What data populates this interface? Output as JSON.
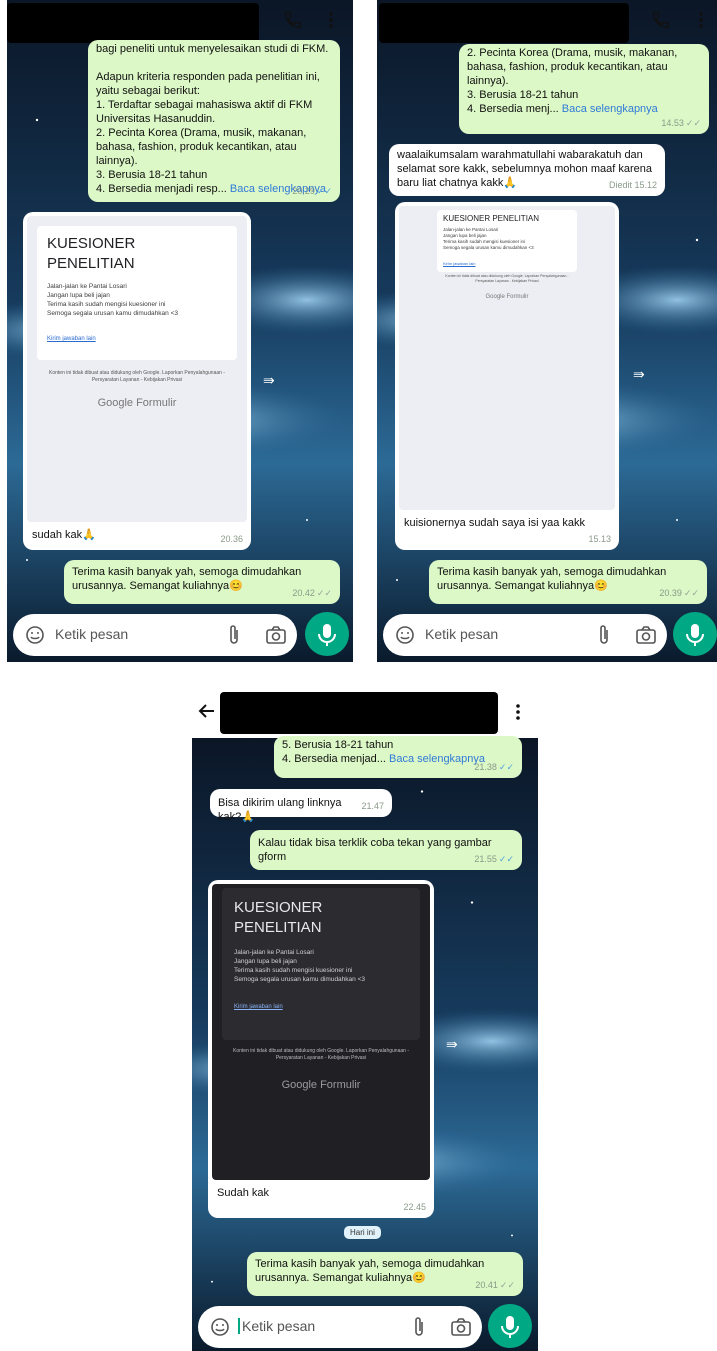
{
  "colors": {
    "accent": "#00a884",
    "outgoing": "#dcf8c6",
    "incoming": "#ffffff",
    "read_tick": "#4fa3e0",
    "link": "#2f7ad8"
  },
  "icons": {
    "call": "phone-icon",
    "menu": "more-vert-icon",
    "back": "back-arrow-icon",
    "emoji": "emoji-icon",
    "attach": "paperclip-icon",
    "camera": "camera-icon",
    "mic": "mic-icon",
    "forward": "forward-icon"
  },
  "read_more": "Baca selengkapnya",
  "input_placeholder": "Ketik pesan",
  "form": {
    "title": "KUESIONER PENELITIAN",
    "body": "Jalan-jalan ke Pantai Losari\nJangan lupa beli jajan\nTerima kasih sudah mengisi kuesioner ini\nSemoga segala urusan kamu dimudahkan <3",
    "link": "Kirim jawaban lain",
    "footer": "Konten ini tidak dibuat atau didukung oleh Google. Laporkan Penyalahgunaan - Persyaratan Layanan - Kebijakan Privasi",
    "brand": "Google Formulir"
  },
  "shot1": {
    "msg1": {
      "text": "bagi peneliti untuk menyelesaikan studi di FKM.\n\nAdapun kriteria responden pada penelitian ini, yaitu sebagai berikut:\n1. Terdaftar sebagai mahasiswa aktif di FKM Universitas Hasanuddin.\n2. Pecinta Korea (Drama, musik, makanan, bahasa, fashion, produk kecantikan, atau lainnya).\n3. Berusia 18-21 tahun\n4. Bersedia menjadi resp...",
      "time": "20.29"
    },
    "msg2": {
      "text": "sudah kak🙏",
      "time": "20.36"
    },
    "msg3": {
      "text": "Terima kasih banyak yah, semoga dimudahkan urusannya. Semangat kuliahnya😊",
      "time": "20.42"
    }
  },
  "shot2": {
    "msg1": {
      "text": "2. Pecinta Korea (Drama, musik, makanan, bahasa, fashion, produk kecantikan, atau lainnya).\n3. Berusia 18-21 tahun\n4. Bersedia menj...",
      "time": "14.53"
    },
    "msg2": {
      "text": "waalaikumsalam warahmatullahi wabarakatuh dan selamat sore kakk, sebelumnya mohon maaf karena baru liat chatnya kakk🙏",
      "time": "Diedit 15.12"
    },
    "msg3": {
      "text": "kuisionernya sudah saya isi yaa kakk",
      "time": "15.13"
    },
    "msg4": {
      "text": "Terima kasih banyak yah, semoga dimudahkan urusannya. Semangat kuliahnya😊",
      "time": "20.39"
    }
  },
  "shot3": {
    "msg1": {
      "text": "5. Berusia 18-21 tahun\n4. Bersedia menjad...",
      "time": "21.38"
    },
    "msg2": {
      "text": "Bisa dikirim ulang linknya kak?🙏",
      "time": "21.47"
    },
    "msg3": {
      "text": "Kalau tidak bisa terklik coba tekan yang gambar gform",
      "time": "21.55"
    },
    "msg4": {
      "text": "Sudah kak",
      "time": "22.45"
    },
    "date_chip": "Hari ini",
    "msg5": {
      "text": "Terima kasih banyak yah, semoga dimudahkan urusannya. Semangat kuliahnya😊",
      "time": "20.41"
    }
  }
}
